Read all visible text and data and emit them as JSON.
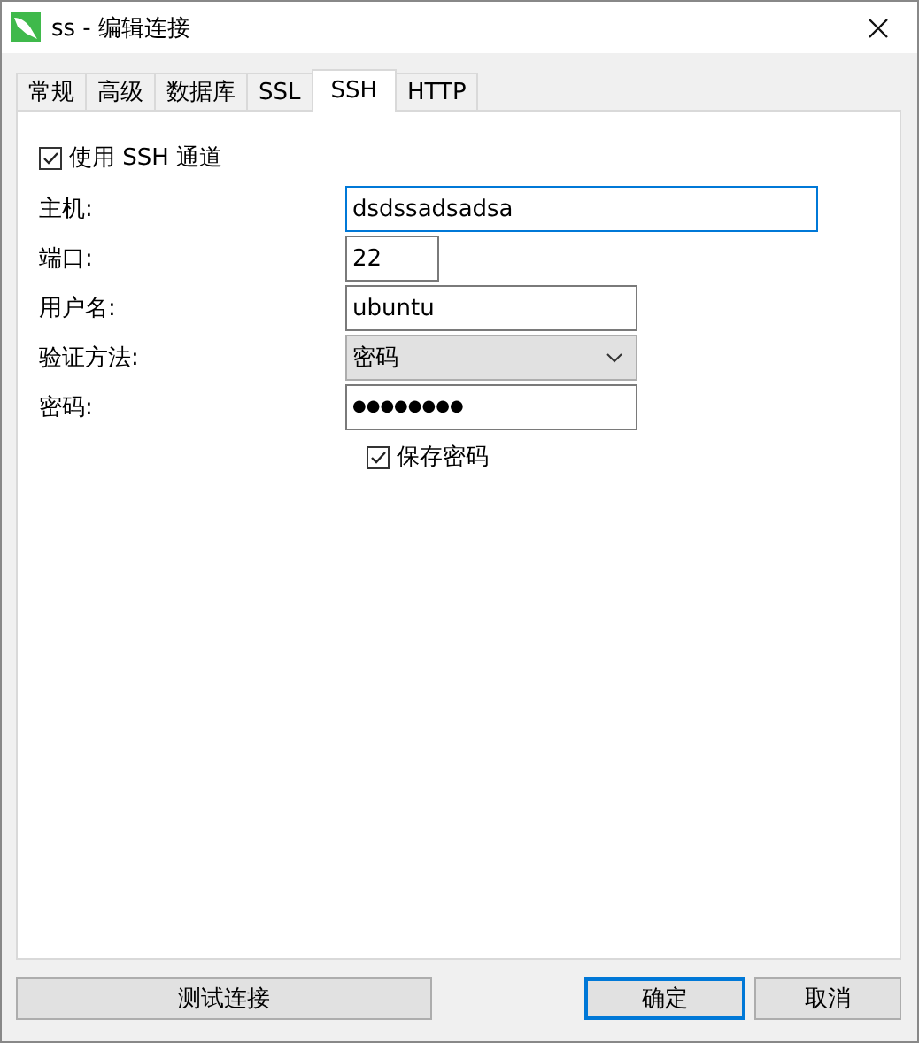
{
  "window": {
    "title": "ss - 编辑连接"
  },
  "tabs": [
    {
      "label": "常规",
      "selected": false
    },
    {
      "label": "高级",
      "selected": false
    },
    {
      "label": "数据库",
      "selected": false
    },
    {
      "label": "SSL",
      "selected": false
    },
    {
      "label": "SSH",
      "selected": true
    },
    {
      "label": "HTTP",
      "selected": false
    }
  ],
  "use_ssh_tunnel": {
    "label": "使用 SSH 通道",
    "checked": true
  },
  "fields": [
    {
      "kind": "text",
      "label": "主机:",
      "value": "dsdssadsadsa",
      "focused": true
    },
    {
      "kind": "text",
      "label": "端口:",
      "value": "22",
      "focused": false
    },
    {
      "kind": "text",
      "label": "用户名:",
      "value": "ubuntu",
      "focused": false
    },
    {
      "kind": "dropdown",
      "label": "验证方法:",
      "value": "密码",
      "focused": false
    },
    {
      "kind": "password",
      "label": "密码:",
      "value": "●●●●●●●●",
      "focused": false
    }
  ],
  "save_password": {
    "label": "保存密码",
    "checked": true
  },
  "buttons": [
    {
      "label": "测试连接",
      "default": false
    },
    {
      "label": "确定",
      "default": true
    },
    {
      "label": "取消",
      "default": false
    }
  ]
}
